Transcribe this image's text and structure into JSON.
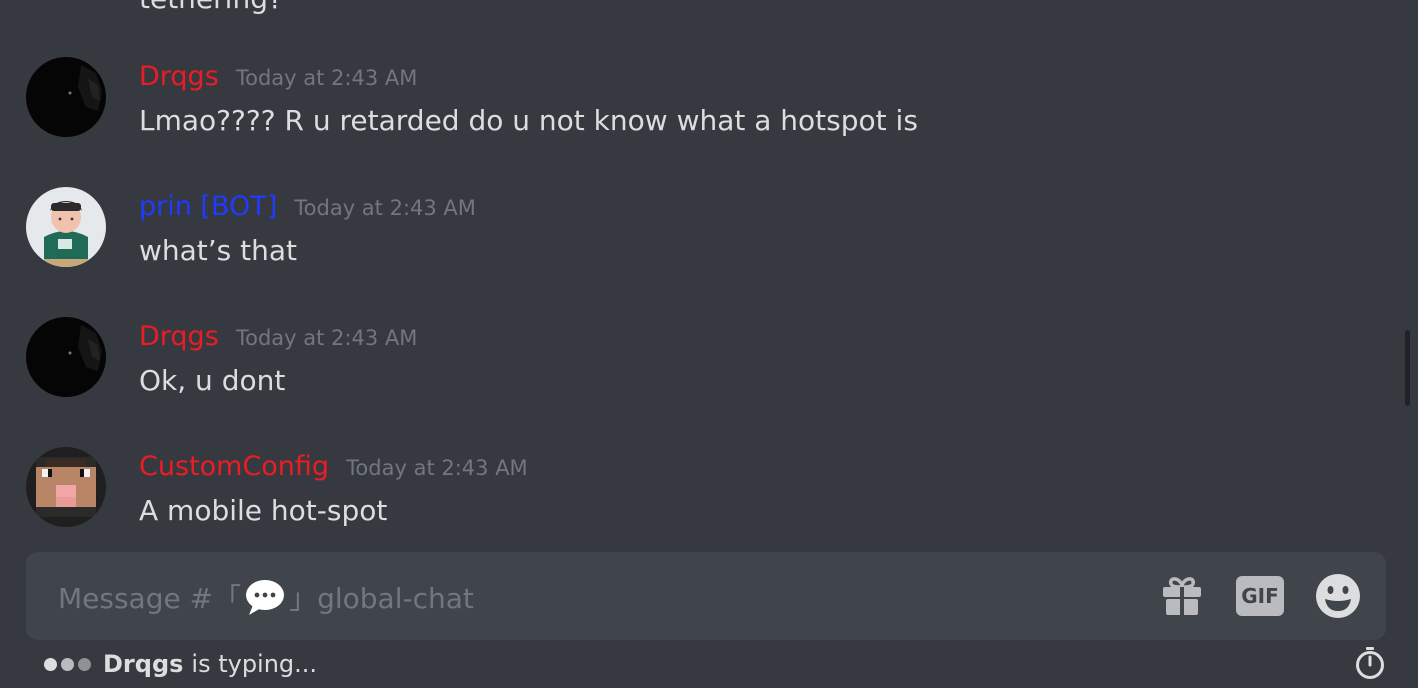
{
  "previous_message_partial": "tethering?",
  "messages": [
    {
      "username": "Drqgs",
      "username_color": "#ed1c24",
      "timestamp": "Today at 2:43 AM",
      "text": "Lmao???? R u retarded do u not know what a hotspot is",
      "avatar": "black-avatar"
    },
    {
      "username": "prin [BOT]",
      "username_color": "#1f3bff",
      "timestamp": "Today at 2:43 AM",
      "text": "what’s that",
      "avatar": "chubby-boy-avatar"
    },
    {
      "username": "Drqgs",
      "username_color": "#ed1c24",
      "timestamp": "Today at 2:43 AM",
      "text": "Ok, u dont",
      "avatar": "black-avatar"
    },
    {
      "username": "CustomConfig",
      "username_color": "#ed1c24",
      "timestamp": "Today at 2:43 AM",
      "text": "A mobile hot-spot",
      "avatar": "pixel-pig-avatar"
    }
  ],
  "composer": {
    "placeholder_prefix": "Message #「",
    "placeholder_suffix": "」global-chat",
    "channel_icon": "speech-bubble-icon",
    "gif_label": "GIF",
    "icons": [
      "gift-icon",
      "gif-icon",
      "emoji-icon"
    ]
  },
  "typing": {
    "name": "Drqgs",
    "text": "is typing..."
  },
  "colors": {
    "background": "#36393f",
    "composer": "#40444b",
    "text": "#dcddde",
    "muted": "#72767d"
  }
}
